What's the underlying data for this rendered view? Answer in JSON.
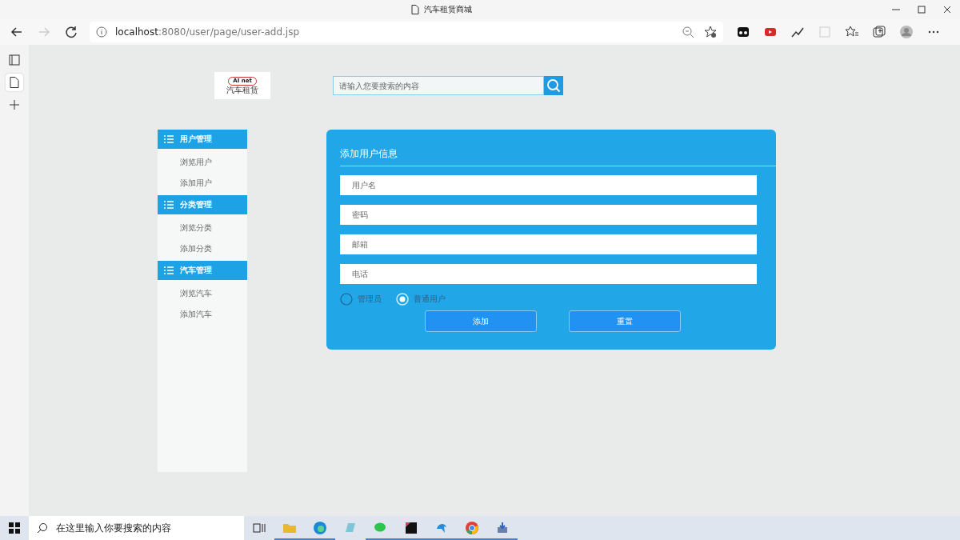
{
  "window": {
    "title": "汽车租赁商城"
  },
  "address_bar": {
    "host": "localhost",
    "path": ":8080/user/page/user-add.jsp"
  },
  "header": {
    "logo_text": "AI net",
    "logo_subtext": "汽车租赁",
    "search": {
      "placeholder": "请输入您要搜索的内容"
    }
  },
  "sidebar": {
    "groups": [
      {
        "title": "用户管理",
        "items": [
          "浏览用户",
          "添加用户"
        ]
      },
      {
        "title": "分类管理",
        "items": [
          "浏览分类",
          "添加分类"
        ]
      },
      {
        "title": "汽车管理",
        "items": [
          "浏览汽车",
          "添加汽车"
        ]
      }
    ]
  },
  "form": {
    "title": "添加用户信息",
    "fields": [
      {
        "placeholder": "用户名"
      },
      {
        "placeholder": "密码"
      },
      {
        "placeholder": "邮箱"
      },
      {
        "placeholder": "电话"
      }
    ],
    "roles": [
      {
        "label": "管理员",
        "selected": false
      },
      {
        "label": "普通用户",
        "selected": true
      }
    ],
    "buttons": [
      "添加",
      "重置"
    ]
  },
  "taskbar": {
    "search": {
      "placeholder": "在这里输入你要搜索的内容"
    }
  }
}
